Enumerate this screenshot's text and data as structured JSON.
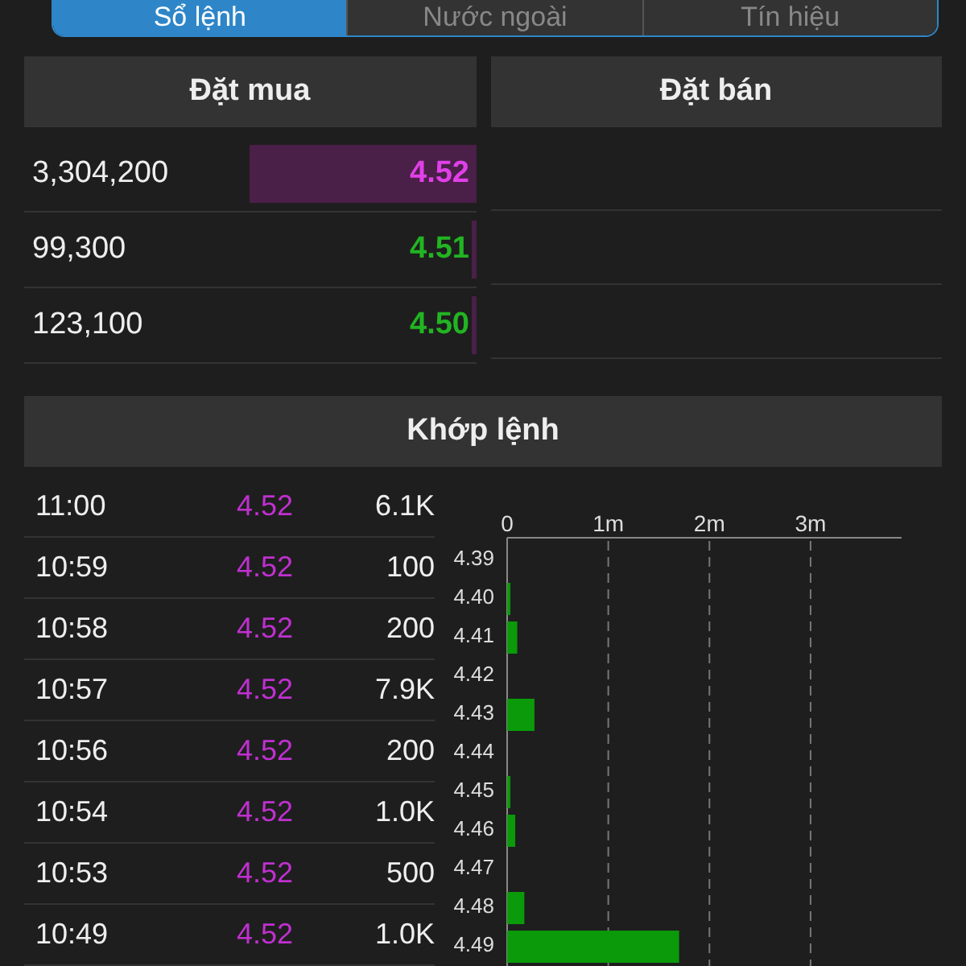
{
  "tabs": [
    {
      "label": "Sổ lệnh",
      "selected": true
    },
    {
      "label": "Nước ngoài",
      "selected": false
    },
    {
      "label": "Tín hiệu",
      "selected": false
    }
  ],
  "order_book": {
    "bid_title": "Đặt mua",
    "ask_title": "Đặt bán",
    "bids": [
      {
        "volume": "3,304,200",
        "price": "4.52",
        "color": "#e040e8",
        "level": 0.5
      },
      {
        "volume": "99,300",
        "price": "4.51",
        "color": "#22b422",
        "level": 0.01
      },
      {
        "volume": "123,100",
        "price": "4.50",
        "color": "#22b422",
        "level": 0.01
      }
    ]
  },
  "matches": {
    "title": "Khớp lệnh",
    "rows": [
      {
        "time": "11:00",
        "price": "4.52",
        "volume": "6.1K"
      },
      {
        "time": "10:59",
        "price": "4.52",
        "volume": "100"
      },
      {
        "time": "10:58",
        "price": "4.52",
        "volume": "200"
      },
      {
        "time": "10:57",
        "price": "4.52",
        "volume": "7.9K"
      },
      {
        "time": "10:56",
        "price": "4.52",
        "volume": "200"
      },
      {
        "time": "10:54",
        "price": "4.52",
        "volume": "1.0K"
      },
      {
        "time": "10:53",
        "price": "4.52",
        "volume": "500"
      },
      {
        "time": "10:49",
        "price": "4.52",
        "volume": "1.0K"
      }
    ],
    "chart_data": {
      "type": "bar",
      "orientation": "horizontal",
      "categories": [
        "4.39",
        "4.40",
        "4.41",
        "4.42",
        "4.43",
        "4.44",
        "4.45",
        "4.46",
        "4.47",
        "4.48",
        "4.49"
      ],
      "xlim": [
        0,
        3.9
      ],
      "grid": true,
      "series": [
        {
          "color": "#0a9a0a",
          "values": [
            0,
            0.01,
            0.1,
            0,
            0.27,
            0,
            0.01,
            0.08,
            0,
            0.17,
            1.7
          ]
        }
      ],
      "xticks": [
        {
          "value": 0,
          "label": "0"
        },
        {
          "value": 1,
          "label": "1m"
        },
        {
          "value": 2,
          "label": "2m"
        },
        {
          "value": 3,
          "label": "3m"
        }
      ]
    }
  }
}
